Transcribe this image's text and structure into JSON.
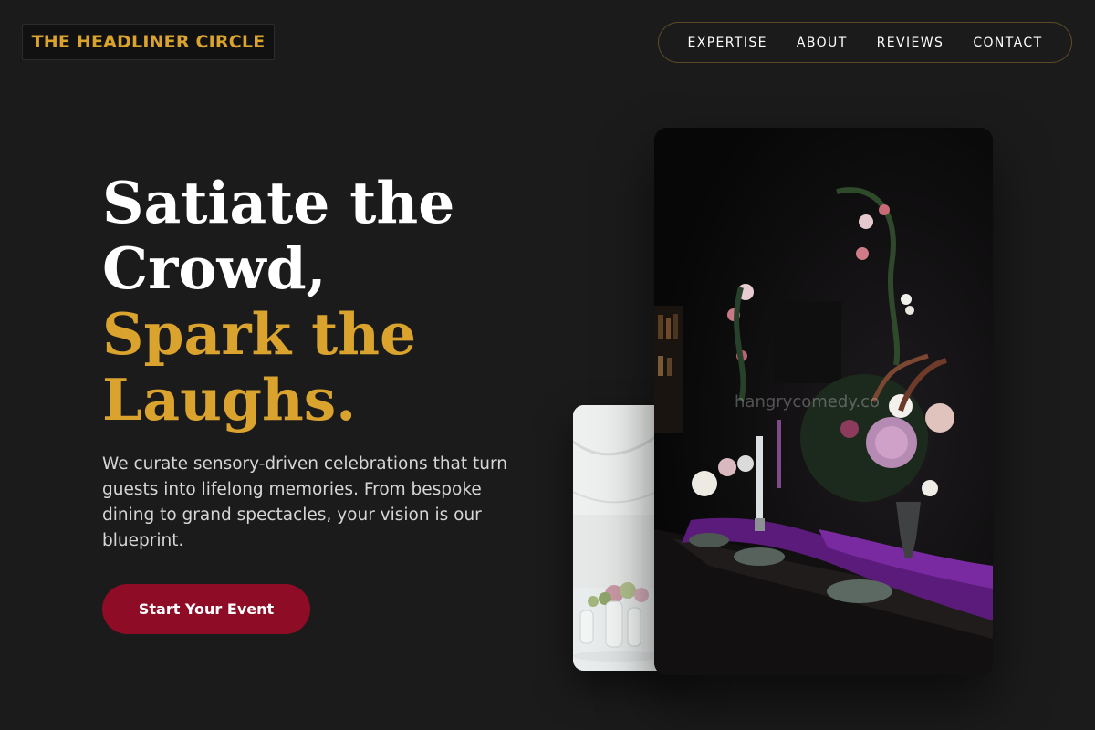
{
  "brand": {
    "name": "THE HEADLINER CIRCLE"
  },
  "nav": {
    "items": [
      "EXPERTISE",
      "ABOUT",
      "REVIEWS",
      "CONTACT"
    ]
  },
  "hero": {
    "line1": "Satiate the",
    "line2": "Crowd,",
    "line3": "Spark the",
    "line4": "Laughs.",
    "description": "We curate sensory-driven celebrations that turn guests into lifelong memories. From bespoke dining to grand spectacles, your vision is our blueprint.",
    "cta": "Start Your Event"
  },
  "images": {
    "watermark": "hangrycomedy.co"
  },
  "colors": {
    "background": "#1b1b1b",
    "accent": "#d9a32e",
    "cta": "#8e0c25"
  }
}
